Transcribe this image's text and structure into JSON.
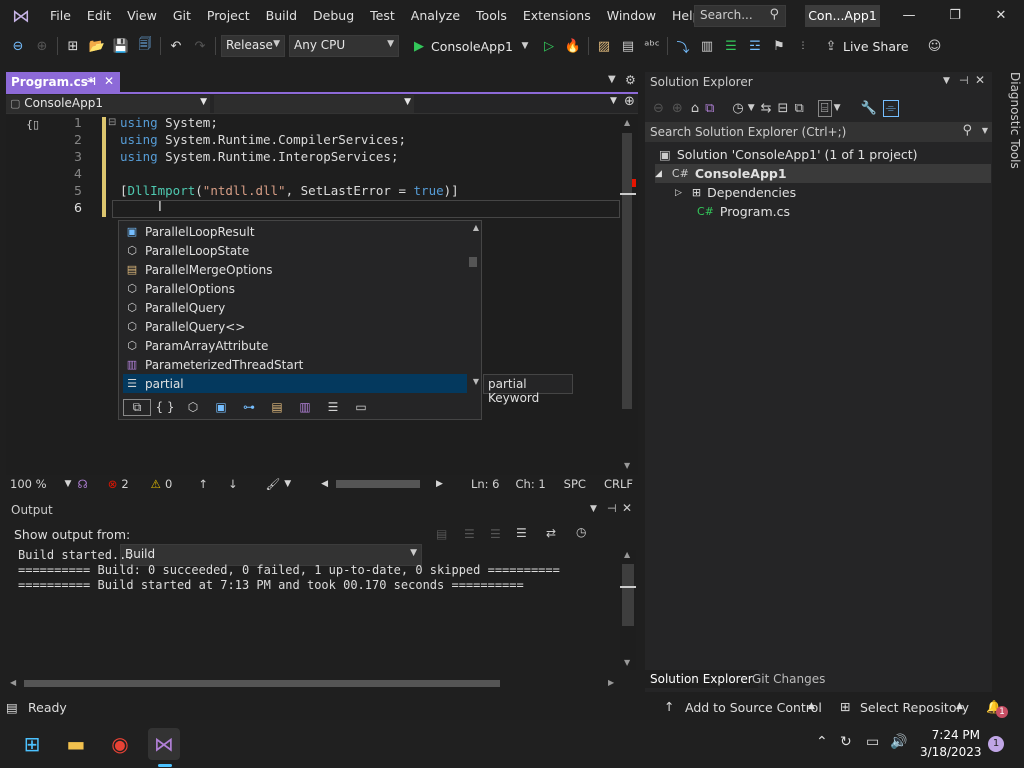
{
  "menu": {
    "items": [
      "File",
      "Edit",
      "View",
      "Git",
      "Project",
      "Build",
      "Debug",
      "Test",
      "Analyze",
      "Tools",
      "Extensions",
      "Window",
      "Help"
    ],
    "search_placeholder": "Search...",
    "window_title": "Con...App1"
  },
  "toolbar": {
    "config": "Release",
    "platform": "Any CPU",
    "start_label": "ConsoleApp1",
    "live_share": "Live Share"
  },
  "doc": {
    "tab_title": "Program.cs*",
    "nav_project": "ConsoleApp1"
  },
  "editor": {
    "line_numbers": [
      "1",
      "2",
      "3",
      "4",
      "5",
      "6"
    ],
    "lines": [
      {
        "kw": "using",
        "rest": " System;"
      },
      {
        "kw": "using",
        "rest": " System.Runtime.CompilerServices;"
      },
      {
        "kw": "using",
        "rest": " System.Runtime.InteropServices;"
      },
      {
        "kw": "",
        "rest": ""
      },
      {
        "kw": "",
        "rest": "[DllImport(\"ntdll.dll\", SetLastError = true)]"
      },
      {
        "kw": "",
        "rest": ""
      }
    ],
    "completion_items": [
      "ParallelLoopResult",
      "ParallelLoopState",
      "ParallelMergeOptions",
      "ParallelOptions",
      "ParallelQuery",
      "ParallelQuery<>",
      "ParamArrayAttribute",
      "ParameterizedThreadStart",
      "partial"
    ],
    "completion_icons": [
      "▣",
      "⬡",
      "▤",
      "⬡",
      "⬡",
      "⬡",
      "⬡",
      "▥",
      "☰"
    ],
    "selected_index": 8,
    "tooltip": "partial Keyword",
    "zoom": "100 %",
    "errors": "2",
    "warnings": "0",
    "ln": "Ln: 6",
    "ch": "Ch: 1",
    "spc": "SPC",
    "crlf": "CRLF"
  },
  "output": {
    "title": "Output",
    "show_from_label": "Show output from:",
    "source": "Build",
    "lines": [
      "Build started...",
      "========== Build: 0 succeeded, 0 failed, 1 up-to-date, 0 skipped ==========",
      "========== Build started at 7:13 PM and took 00.170 seconds =========="
    ]
  },
  "solution": {
    "title": "Solution Explorer",
    "search_placeholder": "Search Solution Explorer (Ctrl+;)",
    "root": "Solution 'ConsoleApp1' (1 of 1 project)",
    "project": "ConsoleApp1",
    "dependencies": "Dependencies",
    "file": "Program.cs",
    "tab1": "Solution Explorer",
    "tab2": "Git Changes",
    "diagnostic": "Diagnostic Tools"
  },
  "status": {
    "ready": "Ready",
    "add_source": "Add to Source Control",
    "select_repo": "Select Repository",
    "notifications": "1"
  },
  "taskbar": {
    "time": "7:24 PM",
    "date": "3/18/2023",
    "notif_count": "1"
  },
  "colors": {
    "accent": "#8d6ad8",
    "keyword": "#569cd6",
    "string": "#d69d85",
    "type": "#4ec9b0"
  }
}
